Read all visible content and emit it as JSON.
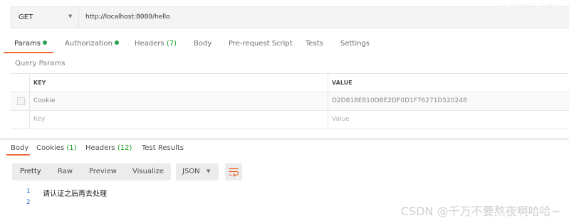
{
  "request": {
    "method": "GET",
    "url": "http://localhost:8080/hello"
  },
  "watermark_top": "DDKK.COM",
  "request_tabs": [
    {
      "label": "Params",
      "dot": true,
      "active": true
    },
    {
      "label": "Authorization",
      "dot": true
    },
    {
      "label": "Headers",
      "count": "(7)"
    },
    {
      "label": "Body"
    },
    {
      "label": "Pre-request Script"
    },
    {
      "label": "Tests"
    },
    {
      "label": "Settings"
    }
  ],
  "query_params": {
    "title": "Query Params",
    "headers": {
      "key": "KEY",
      "value": "VALUE"
    },
    "rows": [
      {
        "key": "Cookie",
        "value": "D2D818E810DBE2DF0D1F76271D520248"
      }
    ],
    "placeholder": {
      "key": "Key",
      "value": "Value"
    }
  },
  "response_tabs": [
    {
      "label": "Body",
      "active": true
    },
    {
      "label": "Cookies",
      "count": "(1)"
    },
    {
      "label": "Headers",
      "count": "(12)"
    },
    {
      "label": "Test Results"
    }
  ],
  "response_views": [
    "Pretty",
    "Raw",
    "Preview",
    "Visualize"
  ],
  "response_format": "JSON",
  "icons": {
    "wrap": "wrap-lines-icon",
    "caret": "chevron-down-icon"
  },
  "code_lines": [
    {
      "num": "1",
      "text": "请认证之后再去处理"
    },
    {
      "num": "2",
      "text": ""
    }
  ],
  "watermark_bottom": "CSDN @千万不要熬夜啊哈哈~",
  "colors": {
    "accent": "#f26b3a",
    "dot": "#24a24b",
    "count": "#18a11f",
    "line_number": "#2a64c5",
    "wrap_icon": "#f26b3a"
  }
}
